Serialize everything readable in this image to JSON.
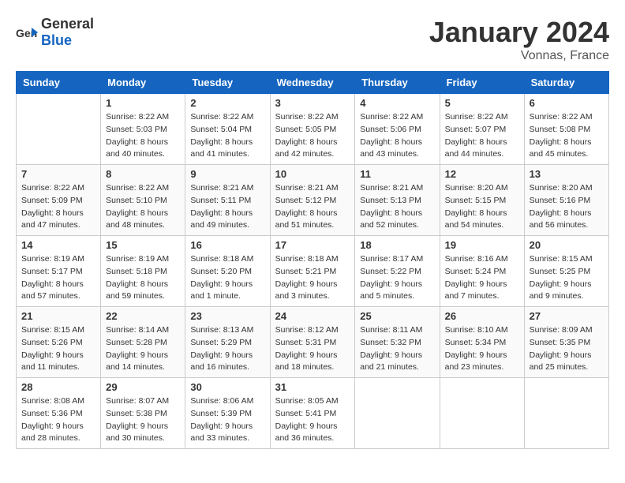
{
  "header": {
    "logo_general": "General",
    "logo_blue": "Blue",
    "month_title": "January 2024",
    "location": "Vonnas, France"
  },
  "columns": [
    "Sunday",
    "Monday",
    "Tuesday",
    "Wednesday",
    "Thursday",
    "Friday",
    "Saturday"
  ],
  "weeks": [
    [
      {
        "day": "",
        "sunrise": "",
        "sunset": "",
        "daylight": ""
      },
      {
        "day": "1",
        "sunrise": "Sunrise: 8:22 AM",
        "sunset": "Sunset: 5:03 PM",
        "daylight": "Daylight: 8 hours and 40 minutes."
      },
      {
        "day": "2",
        "sunrise": "Sunrise: 8:22 AM",
        "sunset": "Sunset: 5:04 PM",
        "daylight": "Daylight: 8 hours and 41 minutes."
      },
      {
        "day": "3",
        "sunrise": "Sunrise: 8:22 AM",
        "sunset": "Sunset: 5:05 PM",
        "daylight": "Daylight: 8 hours and 42 minutes."
      },
      {
        "day": "4",
        "sunrise": "Sunrise: 8:22 AM",
        "sunset": "Sunset: 5:06 PM",
        "daylight": "Daylight: 8 hours and 43 minutes."
      },
      {
        "day": "5",
        "sunrise": "Sunrise: 8:22 AM",
        "sunset": "Sunset: 5:07 PM",
        "daylight": "Daylight: 8 hours and 44 minutes."
      },
      {
        "day": "6",
        "sunrise": "Sunrise: 8:22 AM",
        "sunset": "Sunset: 5:08 PM",
        "daylight": "Daylight: 8 hours and 45 minutes."
      }
    ],
    [
      {
        "day": "7",
        "sunrise": "Sunrise: 8:22 AM",
        "sunset": "Sunset: 5:09 PM",
        "daylight": "Daylight: 8 hours and 47 minutes."
      },
      {
        "day": "8",
        "sunrise": "Sunrise: 8:22 AM",
        "sunset": "Sunset: 5:10 PM",
        "daylight": "Daylight: 8 hours and 48 minutes."
      },
      {
        "day": "9",
        "sunrise": "Sunrise: 8:21 AM",
        "sunset": "Sunset: 5:11 PM",
        "daylight": "Daylight: 8 hours and 49 minutes."
      },
      {
        "day": "10",
        "sunrise": "Sunrise: 8:21 AM",
        "sunset": "Sunset: 5:12 PM",
        "daylight": "Daylight: 8 hours and 51 minutes."
      },
      {
        "day": "11",
        "sunrise": "Sunrise: 8:21 AM",
        "sunset": "Sunset: 5:13 PM",
        "daylight": "Daylight: 8 hours and 52 minutes."
      },
      {
        "day": "12",
        "sunrise": "Sunrise: 8:20 AM",
        "sunset": "Sunset: 5:15 PM",
        "daylight": "Daylight: 8 hours and 54 minutes."
      },
      {
        "day": "13",
        "sunrise": "Sunrise: 8:20 AM",
        "sunset": "Sunset: 5:16 PM",
        "daylight": "Daylight: 8 hours and 56 minutes."
      }
    ],
    [
      {
        "day": "14",
        "sunrise": "Sunrise: 8:19 AM",
        "sunset": "Sunset: 5:17 PM",
        "daylight": "Daylight: 8 hours and 57 minutes."
      },
      {
        "day": "15",
        "sunrise": "Sunrise: 8:19 AM",
        "sunset": "Sunset: 5:18 PM",
        "daylight": "Daylight: 8 hours and 59 minutes."
      },
      {
        "day": "16",
        "sunrise": "Sunrise: 8:18 AM",
        "sunset": "Sunset: 5:20 PM",
        "daylight": "Daylight: 9 hours and 1 minute."
      },
      {
        "day": "17",
        "sunrise": "Sunrise: 8:18 AM",
        "sunset": "Sunset: 5:21 PM",
        "daylight": "Daylight: 9 hours and 3 minutes."
      },
      {
        "day": "18",
        "sunrise": "Sunrise: 8:17 AM",
        "sunset": "Sunset: 5:22 PM",
        "daylight": "Daylight: 9 hours and 5 minutes."
      },
      {
        "day": "19",
        "sunrise": "Sunrise: 8:16 AM",
        "sunset": "Sunset: 5:24 PM",
        "daylight": "Daylight: 9 hours and 7 minutes."
      },
      {
        "day": "20",
        "sunrise": "Sunrise: 8:15 AM",
        "sunset": "Sunset: 5:25 PM",
        "daylight": "Daylight: 9 hours and 9 minutes."
      }
    ],
    [
      {
        "day": "21",
        "sunrise": "Sunrise: 8:15 AM",
        "sunset": "Sunset: 5:26 PM",
        "daylight": "Daylight: 9 hours and 11 minutes."
      },
      {
        "day": "22",
        "sunrise": "Sunrise: 8:14 AM",
        "sunset": "Sunset: 5:28 PM",
        "daylight": "Daylight: 9 hours and 14 minutes."
      },
      {
        "day": "23",
        "sunrise": "Sunrise: 8:13 AM",
        "sunset": "Sunset: 5:29 PM",
        "daylight": "Daylight: 9 hours and 16 minutes."
      },
      {
        "day": "24",
        "sunrise": "Sunrise: 8:12 AM",
        "sunset": "Sunset: 5:31 PM",
        "daylight": "Daylight: 9 hours and 18 minutes."
      },
      {
        "day": "25",
        "sunrise": "Sunrise: 8:11 AM",
        "sunset": "Sunset: 5:32 PM",
        "daylight": "Daylight: 9 hours and 21 minutes."
      },
      {
        "day": "26",
        "sunrise": "Sunrise: 8:10 AM",
        "sunset": "Sunset: 5:34 PM",
        "daylight": "Daylight: 9 hours and 23 minutes."
      },
      {
        "day": "27",
        "sunrise": "Sunrise: 8:09 AM",
        "sunset": "Sunset: 5:35 PM",
        "daylight": "Daylight: 9 hours and 25 minutes."
      }
    ],
    [
      {
        "day": "28",
        "sunrise": "Sunrise: 8:08 AM",
        "sunset": "Sunset: 5:36 PM",
        "daylight": "Daylight: 9 hours and 28 minutes."
      },
      {
        "day": "29",
        "sunrise": "Sunrise: 8:07 AM",
        "sunset": "Sunset: 5:38 PM",
        "daylight": "Daylight: 9 hours and 30 minutes."
      },
      {
        "day": "30",
        "sunrise": "Sunrise: 8:06 AM",
        "sunset": "Sunset: 5:39 PM",
        "daylight": "Daylight: 9 hours and 33 minutes."
      },
      {
        "day": "31",
        "sunrise": "Sunrise: 8:05 AM",
        "sunset": "Sunset: 5:41 PM",
        "daylight": "Daylight: 9 hours and 36 minutes."
      },
      {
        "day": "",
        "sunrise": "",
        "sunset": "",
        "daylight": ""
      },
      {
        "day": "",
        "sunrise": "",
        "sunset": "",
        "daylight": ""
      },
      {
        "day": "",
        "sunrise": "",
        "sunset": "",
        "daylight": ""
      }
    ]
  ]
}
